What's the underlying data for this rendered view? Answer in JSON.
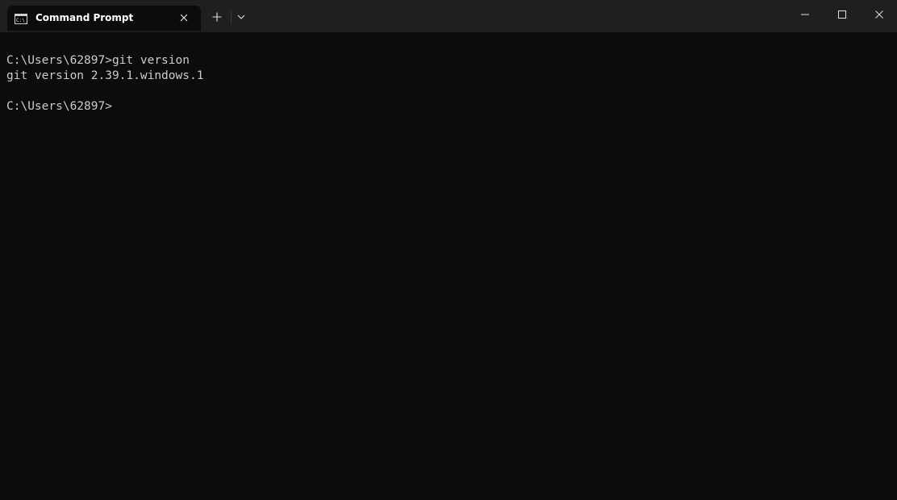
{
  "tab": {
    "title": "Command Prompt",
    "icon": "cmd-icon"
  },
  "titlebar": {
    "new_tab_icon": "plus-icon",
    "dropdown_icon": "chevron-down-icon",
    "minimize_icon": "minimize-icon",
    "maximize_icon": "maximize-icon",
    "close_icon": "close-icon"
  },
  "terminal": {
    "lines": [
      "C:\\Users\\62897>git version",
      "git version 2.39.1.windows.1",
      "",
      "C:\\Users\\62897>"
    ]
  },
  "colors": {
    "background": "#0c0c0c",
    "titlebar": "#1f1f1f",
    "text": "#cccccc"
  }
}
